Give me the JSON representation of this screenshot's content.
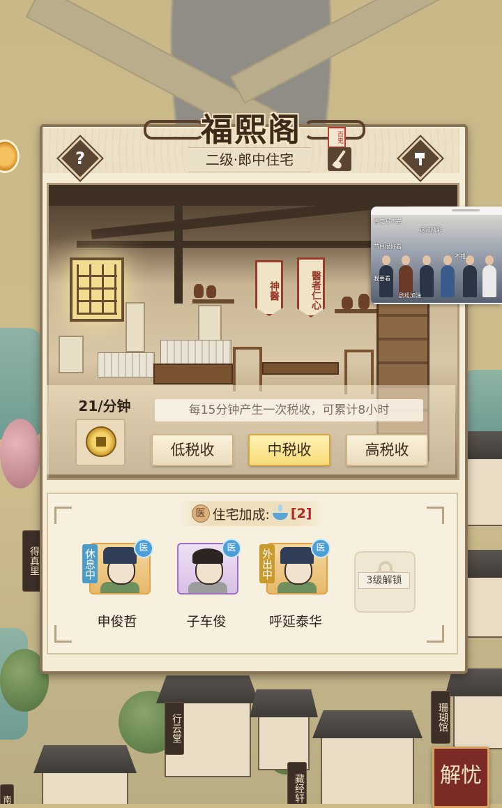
{
  "building": {
    "title": "福熙阁",
    "seal": "百鬼",
    "subtitle": "二级·郎中住宅"
  },
  "room": {
    "banner_left": "神醫",
    "banner_right": "醫者仁心"
  },
  "tax": {
    "rate": "21/分钟",
    "info": "每15分钟产生一次税收，可累计8小时",
    "buttons": [
      "低税收",
      "中税收",
      "高税收"
    ],
    "selected": "中税收"
  },
  "bonus": {
    "med_icon": "医",
    "label": "住宅加成:",
    "count": "[2]"
  },
  "residents": [
    {
      "name": "申俊哲",
      "status": "休息中",
      "badge": "医",
      "frame": "gold"
    },
    {
      "name": "子车俊",
      "status": "",
      "badge": "医",
      "frame": "purple"
    },
    {
      "name": "呼延泰华",
      "status": "外出中",
      "badge": "医",
      "frame": "gold"
    }
  ],
  "locked_slot": {
    "label": "3级解锁"
  },
  "map_labels": {
    "left_plaque": "得真里",
    "bottom_left": "行云堂",
    "bottom_mid": "藏经轩",
    "right": "珊瑚馆",
    "edge": "南"
  },
  "jieyou_button": "解忧",
  "help_glyph": "?",
  "video_overlay": {
    "chat_lines": [
      "肯定写不完",
      "这波精彩",
      "节目很好看",
      "不错",
      "我要看",
      "剧组加油"
    ]
  },
  "colors": {
    "panel_bg": "#f5ecd6",
    "accent_red": "#b3261e",
    "selected_button": "#f7dc78",
    "badge_blue": "#4c9fd4"
  }
}
